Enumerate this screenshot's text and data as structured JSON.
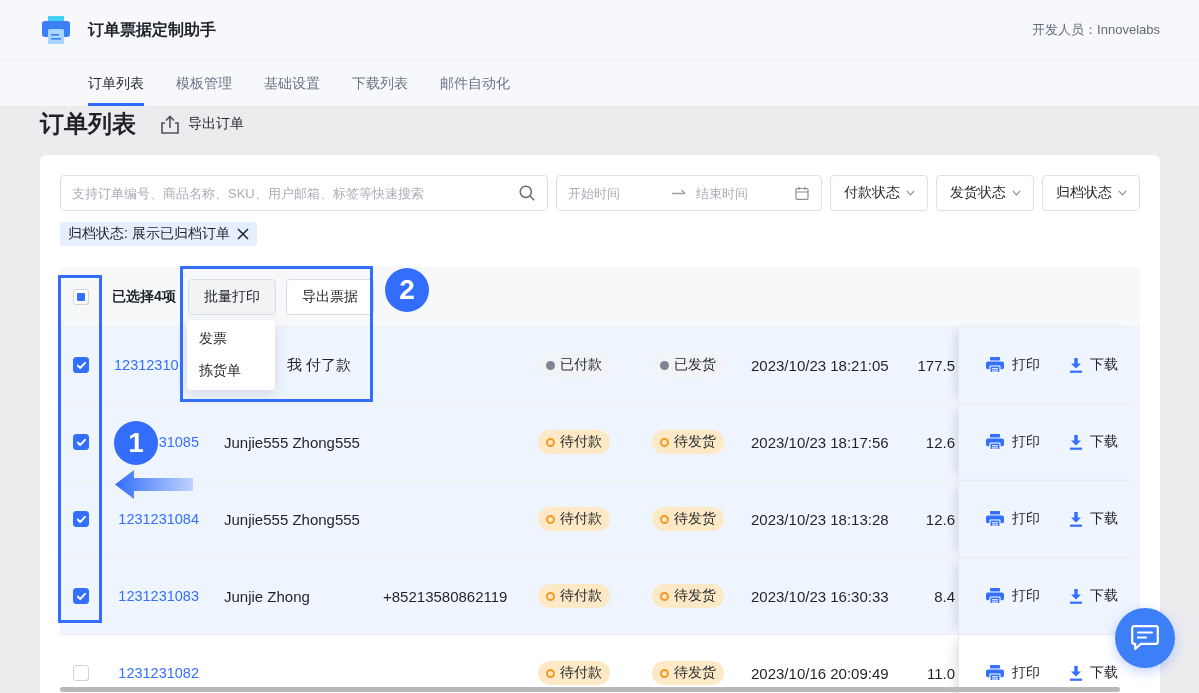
{
  "app_header": {
    "title": "订单票据定制助手",
    "developer": "开发人员：Innovelabs"
  },
  "nav_tabs": [
    {
      "label": "订单列表",
      "selected": true
    },
    {
      "label": "模板管理",
      "selected": false
    },
    {
      "label": "基础设置",
      "selected": false
    },
    {
      "label": "下载列表",
      "selected": false
    },
    {
      "label": "邮件自动化",
      "selected": false
    }
  ],
  "page": {
    "title": "订单列表",
    "export_button": "导出订单"
  },
  "filters": {
    "search": {
      "placeholder": "支持订单编号、商品名称、SKU、用户邮箱、标签等快速搜索"
    },
    "date_range": {
      "start_placeholder": "开始时间",
      "end_placeholder": "结束时间"
    },
    "dropdowns": [
      {
        "label": "付款状态"
      },
      {
        "label": "发货状态"
      },
      {
        "label": "归档状态"
      }
    ]
  },
  "active_filters": [
    {
      "label": "归档状态: 展示已归档订单"
    }
  ],
  "table": {
    "select_all": {
      "indeterminate": true
    },
    "selection_label": "已选择4项",
    "bulk_actions": [
      {
        "label": "批量打印",
        "expanded": true,
        "menu": [
          {
            "label": "发票"
          },
          {
            "label": "拣货单"
          }
        ]
      },
      {
        "label": "导出票据",
        "expanded": false
      }
    ],
    "rows": [
      {
        "checked": true,
        "order_no": "12312310",
        "customer": "我 付了款",
        "payment": {
          "label": "已付款",
          "kind": "done"
        },
        "shipping": {
          "label": "已发货",
          "kind": "done"
        },
        "created": "2023/10/23 18:21:05",
        "amount": "177.5",
        "actions": [
          {
            "kind": "print",
            "label": "打印"
          },
          {
            "kind": "download",
            "label": "下载"
          }
        ]
      },
      {
        "checked": true,
        "order_no": "31085",
        "customer": "Junjie555 Zhong555",
        "payment": {
          "label": "待付款",
          "kind": "pending"
        },
        "shipping": {
          "label": "待发货",
          "kind": "pending"
        },
        "created": "2023/10/23 18:17:56",
        "amount": "12.6",
        "actions": [
          {
            "kind": "print",
            "label": "打印"
          },
          {
            "kind": "download",
            "label": "下载"
          }
        ]
      },
      {
        "checked": true,
        "order_no": "1231231084",
        "customer": "Junjie555 Zhong555",
        "payment": {
          "label": "待付款",
          "kind": "pending"
        },
        "shipping": {
          "label": "待发货",
          "kind": "pending"
        },
        "created": "2023/10/23 18:13:28",
        "amount": "12.6",
        "actions": [
          {
            "kind": "print",
            "label": "打印"
          },
          {
            "kind": "download",
            "label": "下载"
          }
        ]
      },
      {
        "checked": true,
        "order_no": "1231231083",
        "customer": "Junjie Zhong",
        "phone": "+85213580862119",
        "payment": {
          "label": "待付款",
          "kind": "pending"
        },
        "shipping": {
          "label": "待发货",
          "kind": "pending"
        },
        "created": "2023/10/23 16:30:33",
        "amount": "8.4",
        "actions": [
          {
            "kind": "print",
            "label": "打印"
          },
          {
            "kind": "download",
            "label": "下载"
          }
        ]
      },
      {
        "checked": false,
        "order_no": "1231231082",
        "payment": {
          "label": "待付款",
          "kind": "pending"
        },
        "shipping": {
          "label": "待发货",
          "kind": "pending"
        },
        "created": "2023/10/16 20:09:49",
        "amount": "11.0",
        "actions": [
          {
            "kind": "print",
            "label": "打印"
          },
          {
            "kind": "download",
            "label": "下载"
          }
        ]
      }
    ]
  },
  "callouts": [
    {
      "number": "1"
    },
    {
      "number": "2"
    }
  ]
}
